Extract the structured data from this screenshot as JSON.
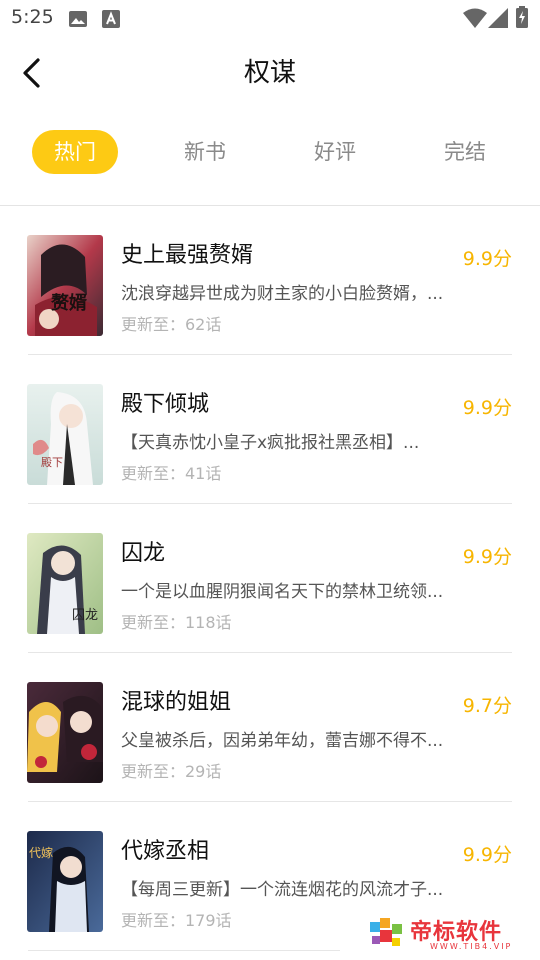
{
  "status_bar": {
    "time": "5:25",
    "icons": [
      "image-icon",
      "a-notification-icon",
      "wifi-icon",
      "signal-icon",
      "battery-icon"
    ]
  },
  "app_bar": {
    "title": "权谋",
    "back_icon": "chevron-left-icon"
  },
  "tabs": [
    {
      "label": "热门",
      "active": true
    },
    {
      "label": "新书",
      "active": false
    },
    {
      "label": "好评",
      "active": false
    },
    {
      "label": "完结",
      "active": false
    }
  ],
  "accent_color": "#fdca14",
  "score_color": "#f7b500",
  "items": [
    {
      "title": "史上最强赘婿",
      "description": "沈浪穿越异世成为财主家的小白脸赘婿，...",
      "update": "更新至：62话",
      "score": "9.9分",
      "cover_text": "史上最强赘婿"
    },
    {
      "title": "殿下倾城",
      "description": "【天真赤忱小皇子x疯批报社黑丞相】...",
      "update": "更新至：41话",
      "score": "9.9分",
      "cover_text": "殿下倾城"
    },
    {
      "title": "囚龙",
      "description": "一个是以血腥阴狠闻名天下的禁林卫统领...",
      "update": "更新至：118话",
      "score": "9.9分",
      "cover_text": "囚龙"
    },
    {
      "title": "混球的姐姐",
      "description": "父皇被杀后，因弟弟年幼，蕾吉娜不得不...",
      "update": "更新至：29话",
      "score": "9.7分",
      "cover_text": ""
    },
    {
      "title": "代嫁丞相",
      "description": "【每周三更新】一个流连烟花的风流才子...",
      "update": "更新至：179话",
      "score": "9.9分",
      "cover_text": "代嫁丞相"
    }
  ],
  "watermark": {
    "text": "帝标软件",
    "sub": "WWW.TIB4.VIP"
  }
}
